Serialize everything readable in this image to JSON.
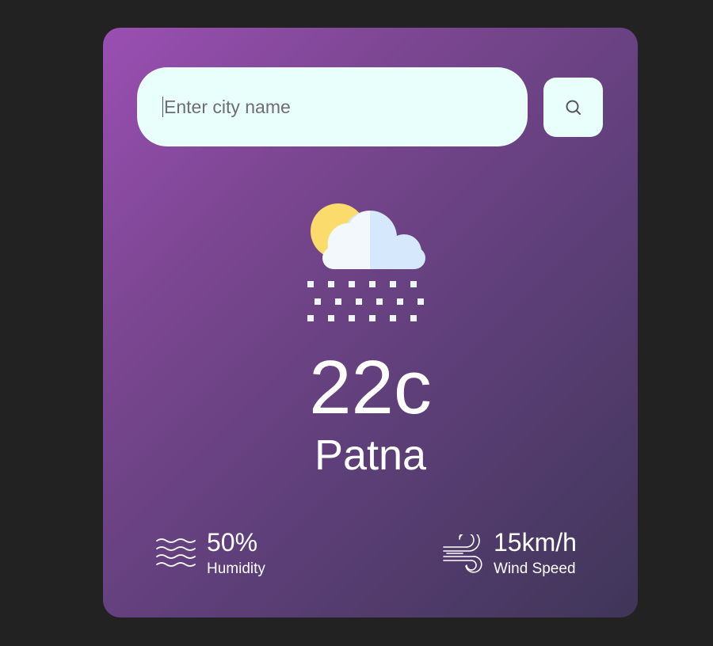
{
  "search": {
    "placeholder": "Enter city name",
    "value": "",
    "button_icon": "search-icon"
  },
  "weather": {
    "icon": "sun-cloud-snow-icon",
    "temperature": "22c",
    "city": "Patna"
  },
  "details": {
    "humidity": {
      "icon": "humidity-waves-icon",
      "value": "50%",
      "label": "Humidity"
    },
    "wind": {
      "icon": "wind-icon",
      "value": "15km/h",
      "label": "Wind Speed"
    }
  },
  "colors": {
    "page_background": "#222222",
    "card_gradient_start": "#9a4fb3",
    "card_gradient_end": "#3f3658",
    "input_background": "#e9fffb",
    "text": "#ffffff",
    "sun": "#fbdb6b",
    "cloud_light": "#f3f8fc",
    "cloud_shade": "#d6e8fb"
  }
}
